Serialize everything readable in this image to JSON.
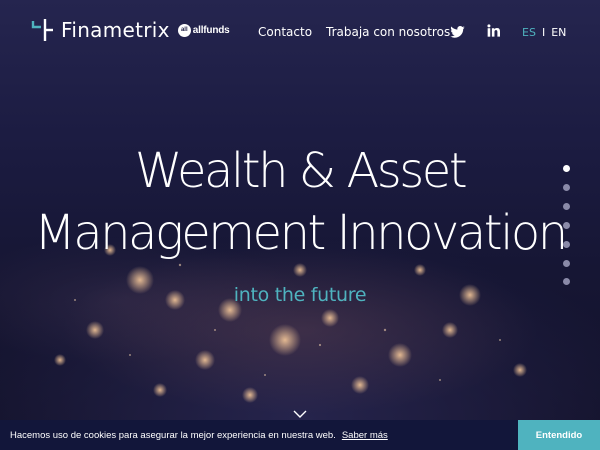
{
  "header": {
    "logo_text": "Finametrix",
    "partner_text": "allfunds",
    "partner_badge": "all",
    "nav": [
      {
        "label": "Contacto"
      },
      {
        "label": "Trabaja con nosotros"
      }
    ],
    "social_icons": [
      "twitter-icon",
      "linkedin-icon"
    ],
    "languages": {
      "active": "ES",
      "separator": "I",
      "other": "EN"
    }
  },
  "hero": {
    "headline_line1": "Wealth & Asset",
    "headline_line2": "Management Innovation",
    "subline": "into the future",
    "slide_dots": {
      "count": 7,
      "active_index": 0
    }
  },
  "cookie_bar": {
    "text": "Hacemos uso de cookies para asegurar la mejor experiencia en nuestra web.",
    "link_label": "Saber más",
    "button_label": "Entendido"
  },
  "colors": {
    "accent": "#4fb3bf",
    "background": "#171833",
    "cookie_bar": "#12163a"
  }
}
